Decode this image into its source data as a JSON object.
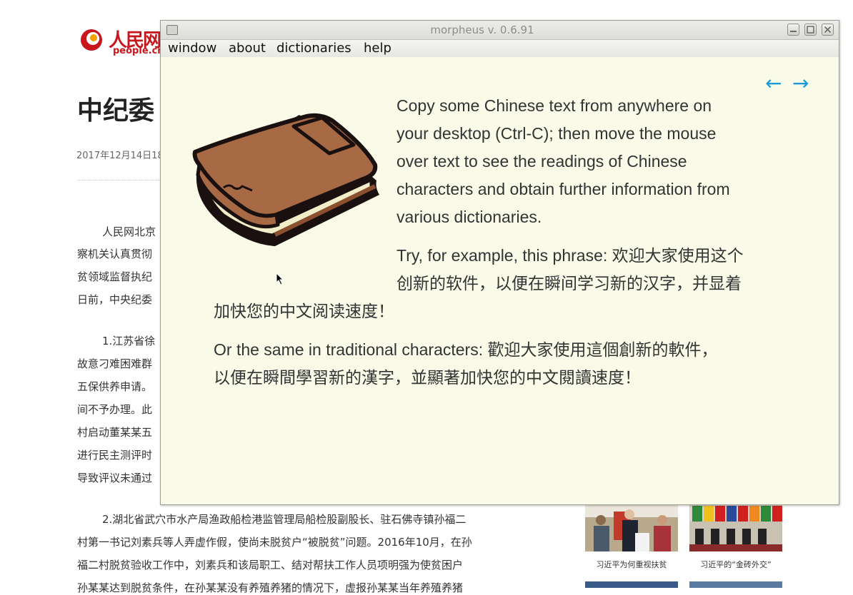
{
  "background_page": {
    "logo": {
      "text_cn": "人民网",
      "text_en": "people.cn",
      "brand_color": "#c8161d"
    },
    "title": "中纪委",
    "date": "2017年12月14日18",
    "paragraphs": [
      "人民网北京",
      "察机关认真贯彻",
      "贫领域监督执纪",
      "日前，中央纪委",
      "1.江苏省徐",
      "故意刁难困难群",
      "五保供养申请。",
      "间不予办理。此",
      "村启动董某某五",
      "进行民主测评时",
      "导致评议未通过",
      "2.湖北省武穴市水产局渔政船检港监管理局船检股副股长、驻石佛寺镇孙福二",
      "村第一书记刘素兵等人弄虚作假，使尚未脱贫户“被脱贫”问题。2016年10月，在孙",
      "福二村脱贫验收工作中，刘素兵和该局职工、结对帮扶工作人员项明强为使贫困户",
      "孙某某达到脱贫条件，在孙某某没有养殖养猪的情况下，虚报孙某某当年养殖养猪"
    ],
    "thumbnails": [
      {
        "caption": "习近平为何重视扶贫"
      },
      {
        "caption": "习近平的“金砖外交”"
      }
    ]
  },
  "window": {
    "title": "morpheus v. 0.6.91",
    "controls": {
      "minimize": "minimize-icon",
      "maximize": "maximize-icon",
      "close": "close-icon"
    },
    "menu": [
      "window",
      "about",
      "dictionaries",
      "help"
    ],
    "nav": {
      "back": "←",
      "forward": "→",
      "accent": "#1a9ad6"
    },
    "background": "#fafae9",
    "content": {
      "intro_lines": [
        "Copy some Chinese text from anywhere on",
        "your desktop (Ctrl-C); then move the mouse",
        "over text to see the readings of Chinese",
        "characters and obtain further information from",
        "various dictionaries."
      ],
      "example_lines": [
        "Try, for example, this phrase: 欢迎大家使用这个",
        "创新的软件，以便在瞬间学习新的汉字，并显着",
        "加快您的中文阅读速度！"
      ],
      "traditional_lines": [
        "Or the same in traditional characters: 歡迎大家使用這個創新的軟件，",
        "以便在瞬間學習新的漢字，並顯著加快您的中文閱讀速度！"
      ]
    },
    "illustration": "book-icon"
  }
}
